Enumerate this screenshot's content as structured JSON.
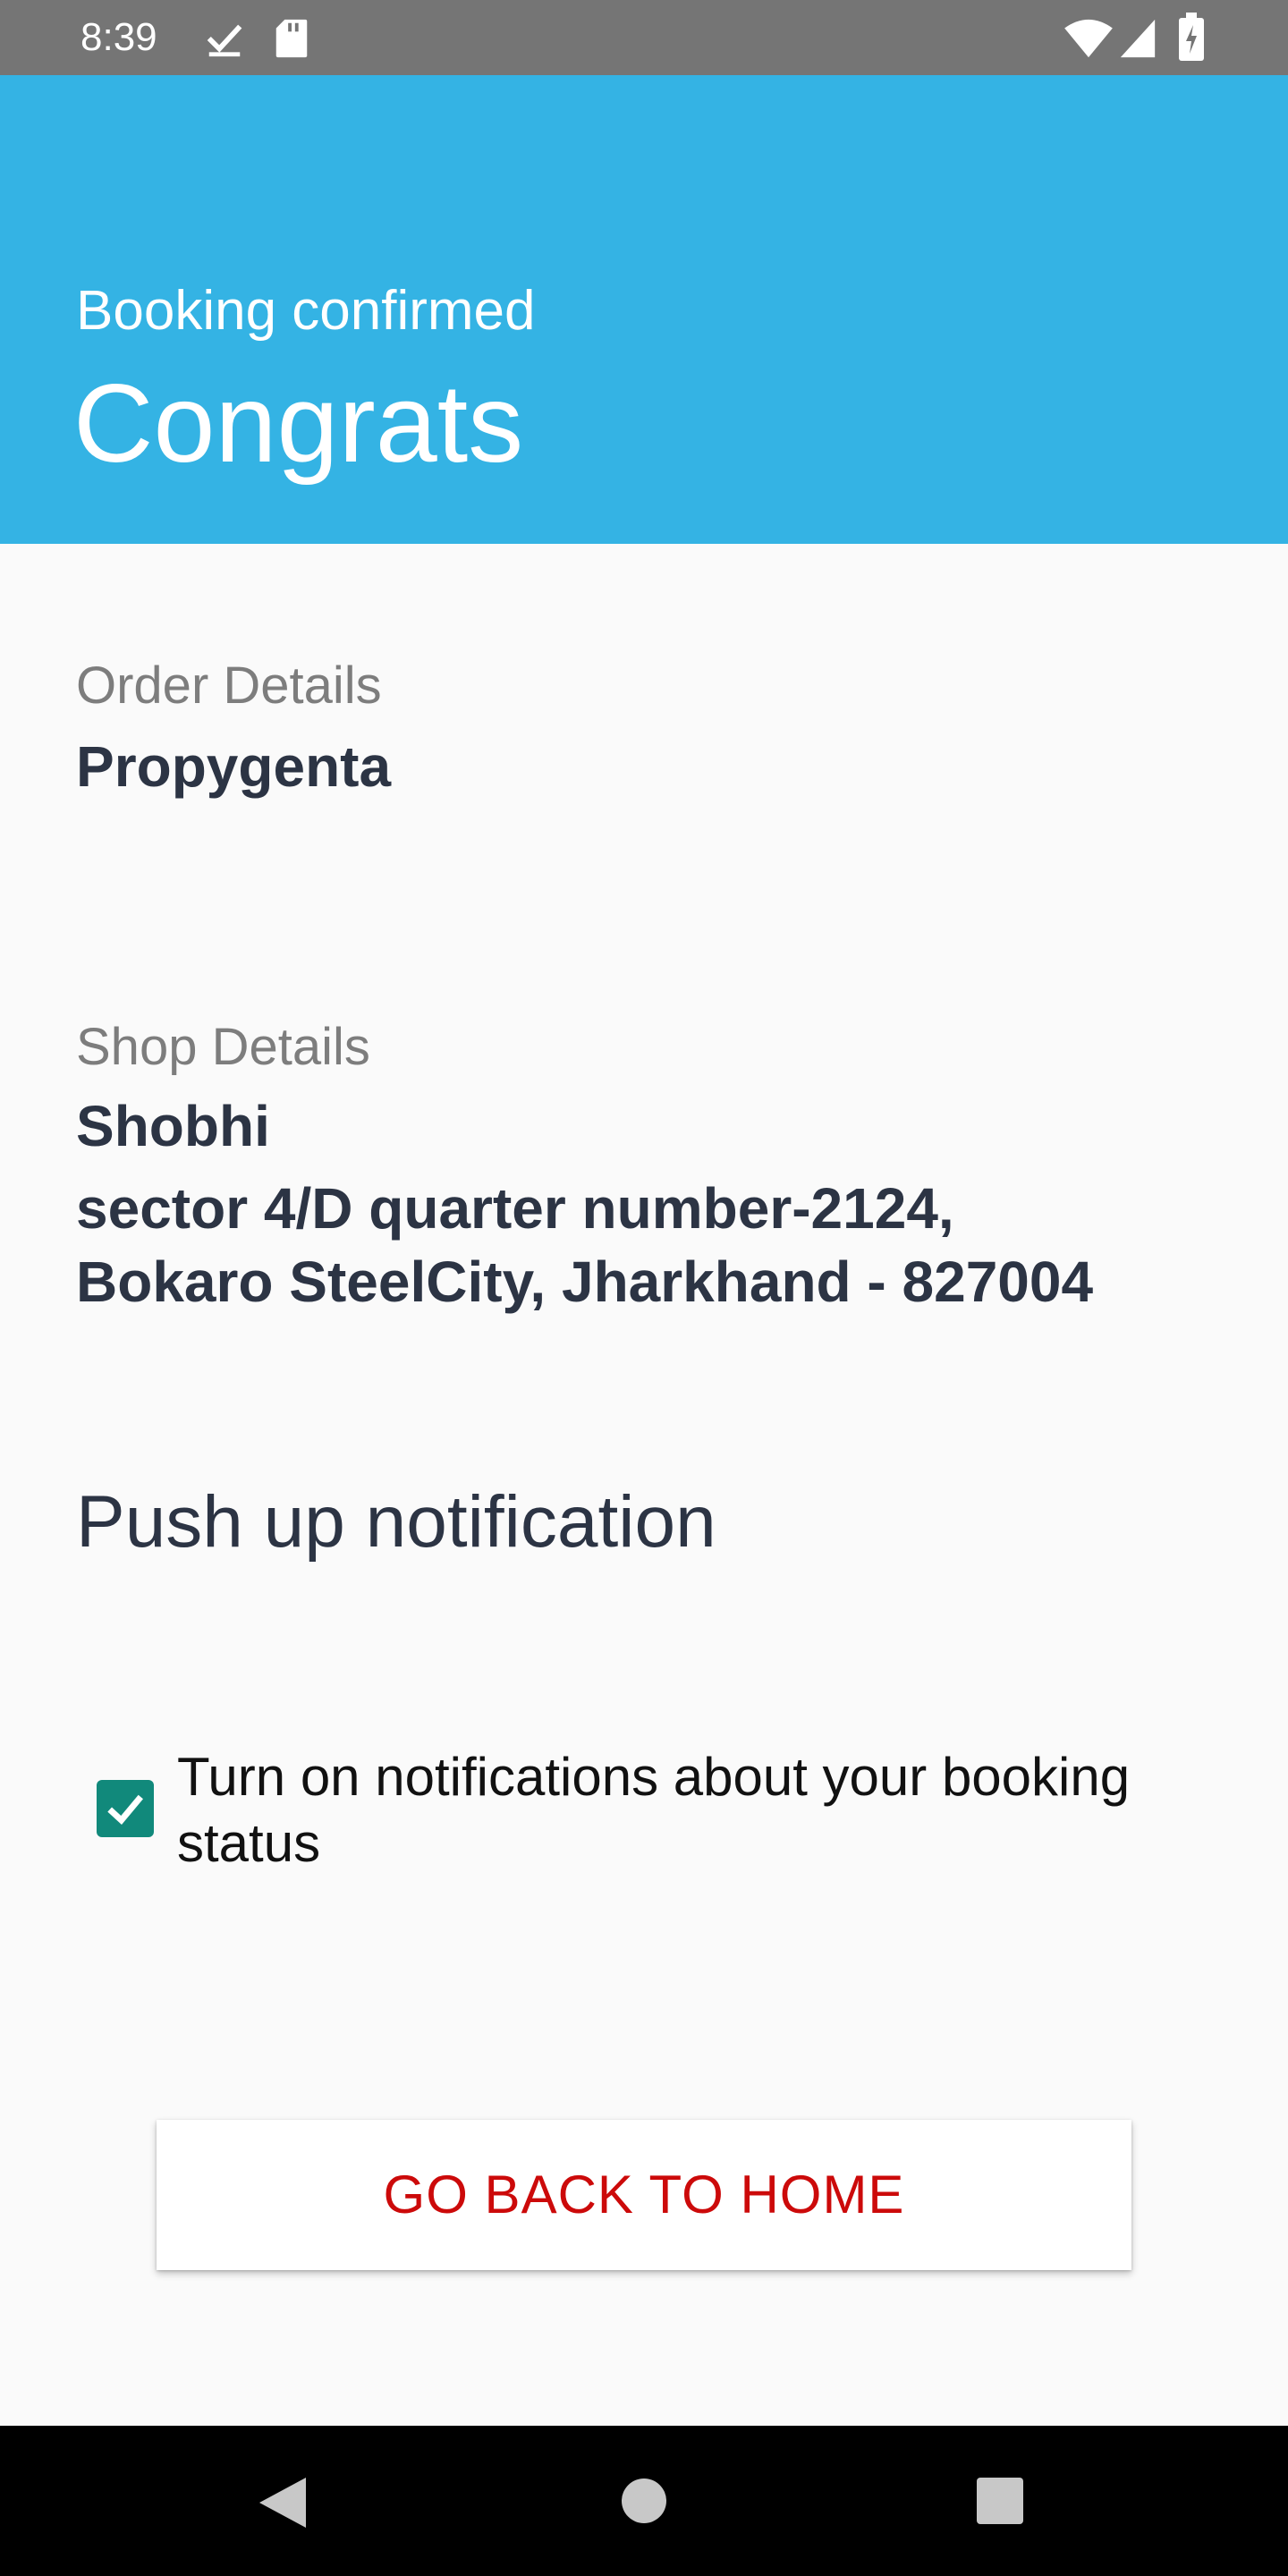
{
  "status_bar": {
    "time": "8:39",
    "icons": [
      "download-done-icon",
      "sd-card-icon",
      "wifi-icon",
      "signal-icon",
      "battery-charging-icon"
    ]
  },
  "header": {
    "subtitle": "Booking confirmed",
    "title": "Congrats",
    "background_color": "#34b3e4"
  },
  "order": {
    "label": "Order Details",
    "name": "Propygenta"
  },
  "shop": {
    "label": "Shop Details",
    "name": "Shobhi",
    "address_line1": "sector 4/D quarter number-2124,",
    "address_line2": "Bokaro SteelCity, Jharkhand - 827004"
  },
  "notification": {
    "title": "Push up notification",
    "checkbox_label": "Turn on notifications about your booking status",
    "checked": true
  },
  "actions": {
    "home_button": "GO BACK TO HOME",
    "home_button_color": "#cc0a0a"
  },
  "nav_bar": {
    "buttons": [
      "back-icon",
      "home-icon",
      "recents-icon"
    ]
  }
}
